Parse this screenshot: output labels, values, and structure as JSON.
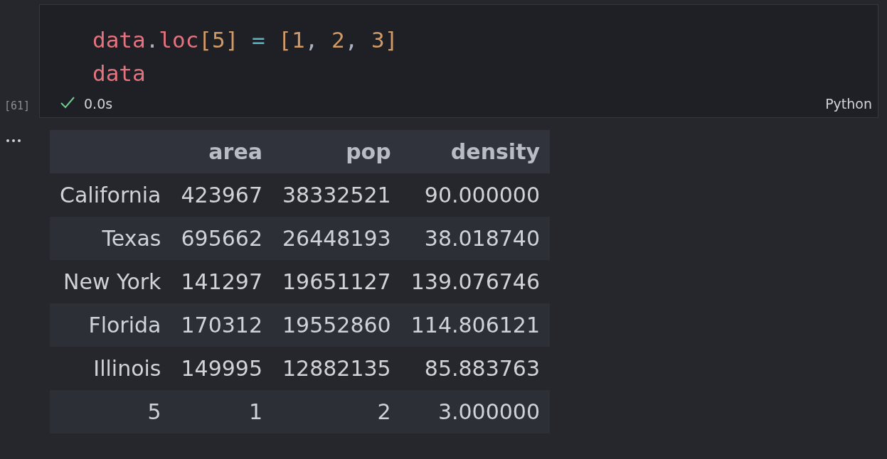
{
  "cell": {
    "execution_count": "[61]",
    "code_lines": [
      [
        {
          "kind": "name",
          "text": "data"
        },
        {
          "kind": "punct",
          "text": "."
        },
        {
          "kind": "name",
          "text": "loc"
        },
        {
          "kind": "bracket",
          "text": "["
        },
        {
          "kind": "number",
          "text": "5"
        },
        {
          "kind": "bracket",
          "text": "]"
        },
        {
          "kind": "operator",
          "text": " = "
        },
        {
          "kind": "bracket",
          "text": "["
        },
        {
          "kind": "number",
          "text": "1"
        },
        {
          "kind": "punct",
          "text": ", "
        },
        {
          "kind": "number",
          "text": "2"
        },
        {
          "kind": "punct",
          "text": ", "
        },
        {
          "kind": "number",
          "text": "3"
        },
        {
          "kind": "bracket",
          "text": "]"
        }
      ],
      [
        {
          "kind": "name",
          "text": "data"
        }
      ]
    ],
    "status": {
      "succeeded": true,
      "duration": "0.0s"
    },
    "language": "Python"
  },
  "output": {
    "table": {
      "columns": [
        "area",
        "pop",
        "density"
      ],
      "rows": [
        {
          "index": "California",
          "cells": [
            "423967",
            "38332521",
            "90.000000"
          ]
        },
        {
          "index": "Texas",
          "cells": [
            "695662",
            "26448193",
            "38.018740"
          ]
        },
        {
          "index": "New York",
          "cells": [
            "141297",
            "19651127",
            "139.076746"
          ]
        },
        {
          "index": "Florida",
          "cells": [
            "170312",
            "19552860",
            "114.806121"
          ]
        },
        {
          "index": "Illinois",
          "cells": [
            "149995",
            "12882135",
            "85.883763"
          ]
        },
        {
          "index": "5",
          "cells": [
            "1",
            "2",
            "3.000000"
          ]
        }
      ]
    }
  }
}
